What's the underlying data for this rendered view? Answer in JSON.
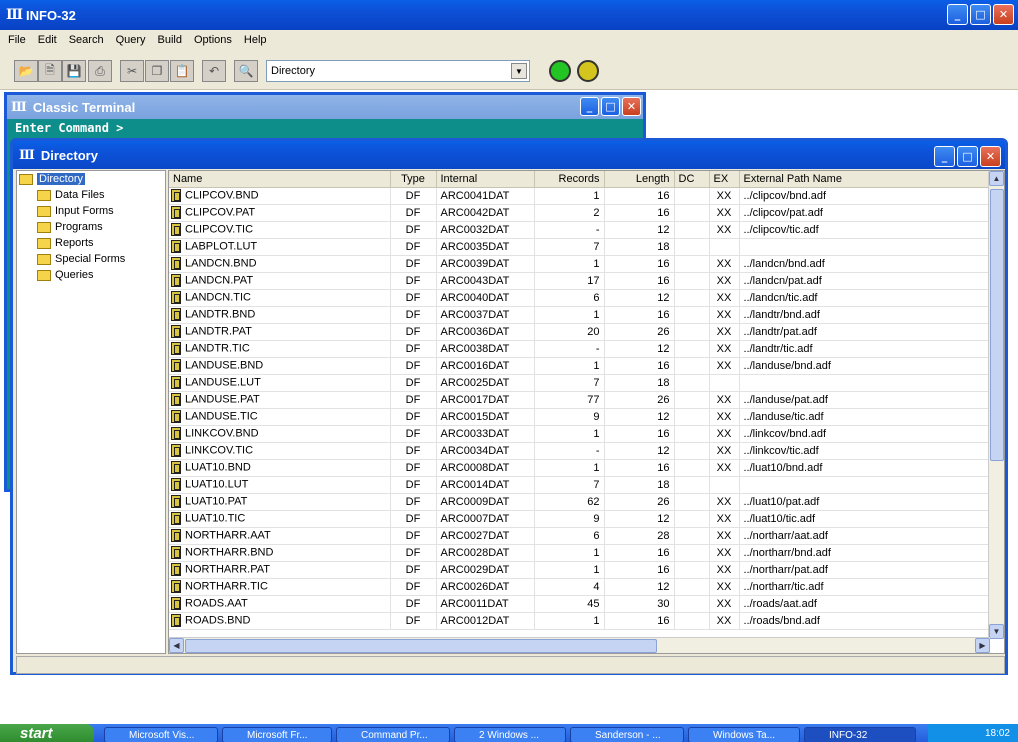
{
  "app": {
    "title": "INFO-32"
  },
  "menu": [
    "File",
    "Edit",
    "Search",
    "Query",
    "Build",
    "Options",
    "Help"
  ],
  "toolbar": {
    "combo_value": "Directory",
    "lights": [
      "#23c523",
      "#d4c41e"
    ]
  },
  "terminal": {
    "title": "Classic Terminal",
    "prompt": "Enter Command >"
  },
  "directory": {
    "title": "Directory",
    "tree": {
      "root": "Directory",
      "children": [
        "Data Files",
        "Input Forms",
        "Programs",
        "Reports",
        "Special Forms",
        "Queries"
      ]
    },
    "columns": [
      "Name",
      "Type",
      "Internal",
      "Records",
      "Length",
      "DC",
      "EX",
      "External Path Name"
    ],
    "rows": [
      [
        "CLIPCOV.BND",
        "DF",
        "ARC0041DAT",
        "1",
        "16",
        "",
        "XX",
        "../clipcov/bnd.adf"
      ],
      [
        "CLIPCOV.PAT",
        "DF",
        "ARC0042DAT",
        "2",
        "16",
        "",
        "XX",
        "../clipcov/pat.adf"
      ],
      [
        "CLIPCOV.TIC",
        "DF",
        "ARC0032DAT",
        "-",
        "12",
        "",
        "XX",
        "../clipcov/tic.adf"
      ],
      [
        "LABPLOT.LUT",
        "DF",
        "ARC0035DAT",
        "7",
        "18",
        "",
        "",
        ""
      ],
      [
        "LANDCN.BND",
        "DF",
        "ARC0039DAT",
        "1",
        "16",
        "",
        "XX",
        "../landcn/bnd.adf"
      ],
      [
        "LANDCN.PAT",
        "DF",
        "ARC0043DAT",
        "17",
        "16",
        "",
        "XX",
        "../landcn/pat.adf"
      ],
      [
        "LANDCN.TIC",
        "DF",
        "ARC0040DAT",
        "6",
        "12",
        "",
        "XX",
        "../landcn/tic.adf"
      ],
      [
        "LANDTR.BND",
        "DF",
        "ARC0037DAT",
        "1",
        "16",
        "",
        "XX",
        "../landtr/bnd.adf"
      ],
      [
        "LANDTR.PAT",
        "DF",
        "ARC0036DAT",
        "20",
        "26",
        "",
        "XX",
        "../landtr/pat.adf"
      ],
      [
        "LANDTR.TIC",
        "DF",
        "ARC0038DAT",
        "-",
        "12",
        "",
        "XX",
        "../landtr/tic.adf"
      ],
      [
        "LANDUSE.BND",
        "DF",
        "ARC0016DAT",
        "1",
        "16",
        "",
        "XX",
        "../landuse/bnd.adf"
      ],
      [
        "LANDUSE.LUT",
        "DF",
        "ARC0025DAT",
        "7",
        "18",
        "",
        "",
        ""
      ],
      [
        "LANDUSE.PAT",
        "DF",
        "ARC0017DAT",
        "77",
        "26",
        "",
        "XX",
        "../landuse/pat.adf"
      ],
      [
        "LANDUSE.TIC",
        "DF",
        "ARC0015DAT",
        "9",
        "12",
        "",
        "XX",
        "../landuse/tic.adf"
      ],
      [
        "LINKCOV.BND",
        "DF",
        "ARC0033DAT",
        "1",
        "16",
        "",
        "XX",
        "../linkcov/bnd.adf"
      ],
      [
        "LINKCOV.TIC",
        "DF",
        "ARC0034DAT",
        "-",
        "12",
        "",
        "XX",
        "../linkcov/tic.adf"
      ],
      [
        "LUAT10.BND",
        "DF",
        "ARC0008DAT",
        "1",
        "16",
        "",
        "XX",
        "../luat10/bnd.adf"
      ],
      [
        "LUAT10.LUT",
        "DF",
        "ARC0014DAT",
        "7",
        "18",
        "",
        "",
        ""
      ],
      [
        "LUAT10.PAT",
        "DF",
        "ARC0009DAT",
        "62",
        "26",
        "",
        "XX",
        "../luat10/pat.adf"
      ],
      [
        "LUAT10.TIC",
        "DF",
        "ARC0007DAT",
        "9",
        "12",
        "",
        "XX",
        "../luat10/tic.adf"
      ],
      [
        "NORTHARR.AAT",
        "DF",
        "ARC0027DAT",
        "6",
        "28",
        "",
        "XX",
        "../northarr/aat.adf"
      ],
      [
        "NORTHARR.BND",
        "DF",
        "ARC0028DAT",
        "1",
        "16",
        "",
        "XX",
        "../northarr/bnd.adf"
      ],
      [
        "NORTHARR.PAT",
        "DF",
        "ARC0029DAT",
        "1",
        "16",
        "",
        "XX",
        "../northarr/pat.adf"
      ],
      [
        "NORTHARR.TIC",
        "DF",
        "ARC0026DAT",
        "4",
        "12",
        "",
        "XX",
        "../northarr/tic.adf"
      ],
      [
        "ROADS.AAT",
        "DF",
        "ARC0011DAT",
        "45",
        "30",
        "",
        "XX",
        "../roads/aat.adf"
      ],
      [
        "ROADS.BND",
        "DF",
        "ARC0012DAT",
        "1",
        "16",
        "",
        "XX",
        "../roads/bnd.adf"
      ]
    ]
  },
  "taskbar": {
    "start": "start",
    "tasks": [
      "Microsoft Vis...",
      "Microsoft Fr...",
      "Command Pr...",
      "2 Windows ...",
      "Sanderson - ...",
      "Windows Ta...",
      "INFO-32"
    ],
    "clock": "18:02"
  }
}
